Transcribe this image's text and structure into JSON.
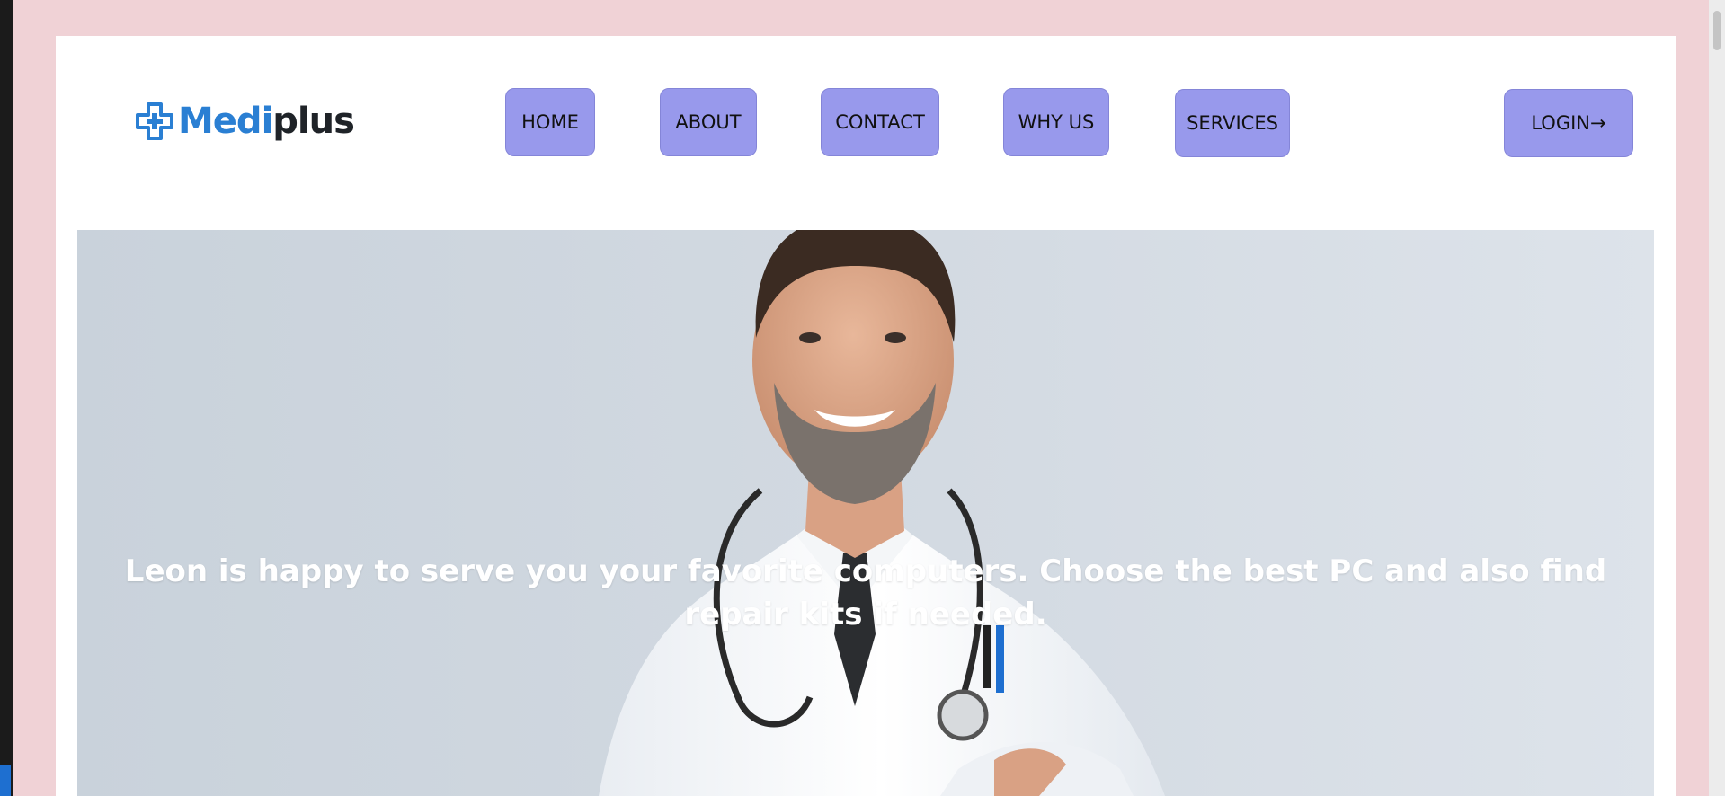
{
  "brand": {
    "name_part1": "Medi",
    "name_part2": "plus",
    "icon": "medical-cross-icon",
    "color_primary": "#2a7fd3"
  },
  "nav": {
    "items": [
      {
        "label": "HOME"
      },
      {
        "label": "ABOUT"
      },
      {
        "label": "CONTACT"
      },
      {
        "label": "WHY US"
      },
      {
        "label": "SERVICES"
      }
    ],
    "login_label": "LOGIN→",
    "button_color": "#9899ec"
  },
  "hero": {
    "text": "Leon is happy to serve you your favorite computers. Choose the best PC and also find repair kits if needed.",
    "image": "smiling-doctor-with-stethoscope"
  },
  "colors": {
    "page_background": "#f0d2d6",
    "card_background": "#ffffff"
  }
}
